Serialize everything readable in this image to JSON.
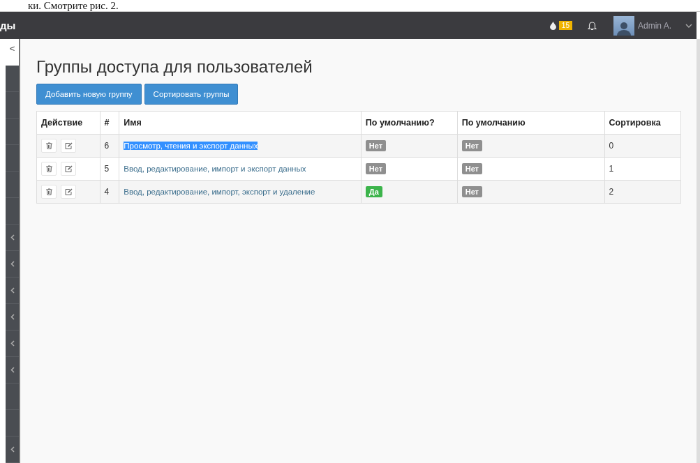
{
  "document_text": "ки. Смотрите рис. 2.",
  "navbar": {
    "brand": "ды",
    "notification_count": "15",
    "user": "Admin A."
  },
  "sidebar": {
    "collapse_arrow": "<",
    "items": [
      {
        "expandable": false
      },
      {
        "expandable": false
      },
      {
        "expandable": false
      },
      {
        "expandable": false
      },
      {
        "expandable": false
      },
      {
        "expandable": false
      },
      {
        "expandable": true
      },
      {
        "expandable": true
      },
      {
        "expandable": true
      },
      {
        "expandable": true
      },
      {
        "expandable": true
      },
      {
        "expandable": true
      },
      {
        "expandable": false
      },
      {
        "expandable": false
      },
      {
        "expandable": true
      }
    ]
  },
  "page_title": "Группы доступа для пользователей",
  "buttons": [
    "Добавить новую группу",
    "Сортировать группы"
  ],
  "table": {
    "columns": [
      "Действие",
      "#",
      "Имя",
      "По умолчанию?",
      "По умолчанию",
      "Сортировка"
    ],
    "rows": [
      {
        "id": "6",
        "name": "Просмотр, чтения и экспорт данных",
        "highlighted": true,
        "default_q": {
          "text": "Нет",
          "kind": "no"
        },
        "default": {
          "text": "Нет",
          "kind": "no"
        },
        "sort": "0"
      },
      {
        "id": "5",
        "name": "Ввод, редактирование, импорт и экспорт данных",
        "highlighted": false,
        "default_q": {
          "text": "Нет",
          "kind": "no"
        },
        "default": {
          "text": "Нет",
          "kind": "no"
        },
        "sort": "1"
      },
      {
        "id": "4",
        "name": "Ввод, редактирование, импорт, экспорт и удаление",
        "highlighted": false,
        "default_q": {
          "text": "Да",
          "kind": "yes"
        },
        "default": {
          "text": "Нет",
          "kind": "no"
        },
        "sort": "2"
      }
    ]
  }
}
